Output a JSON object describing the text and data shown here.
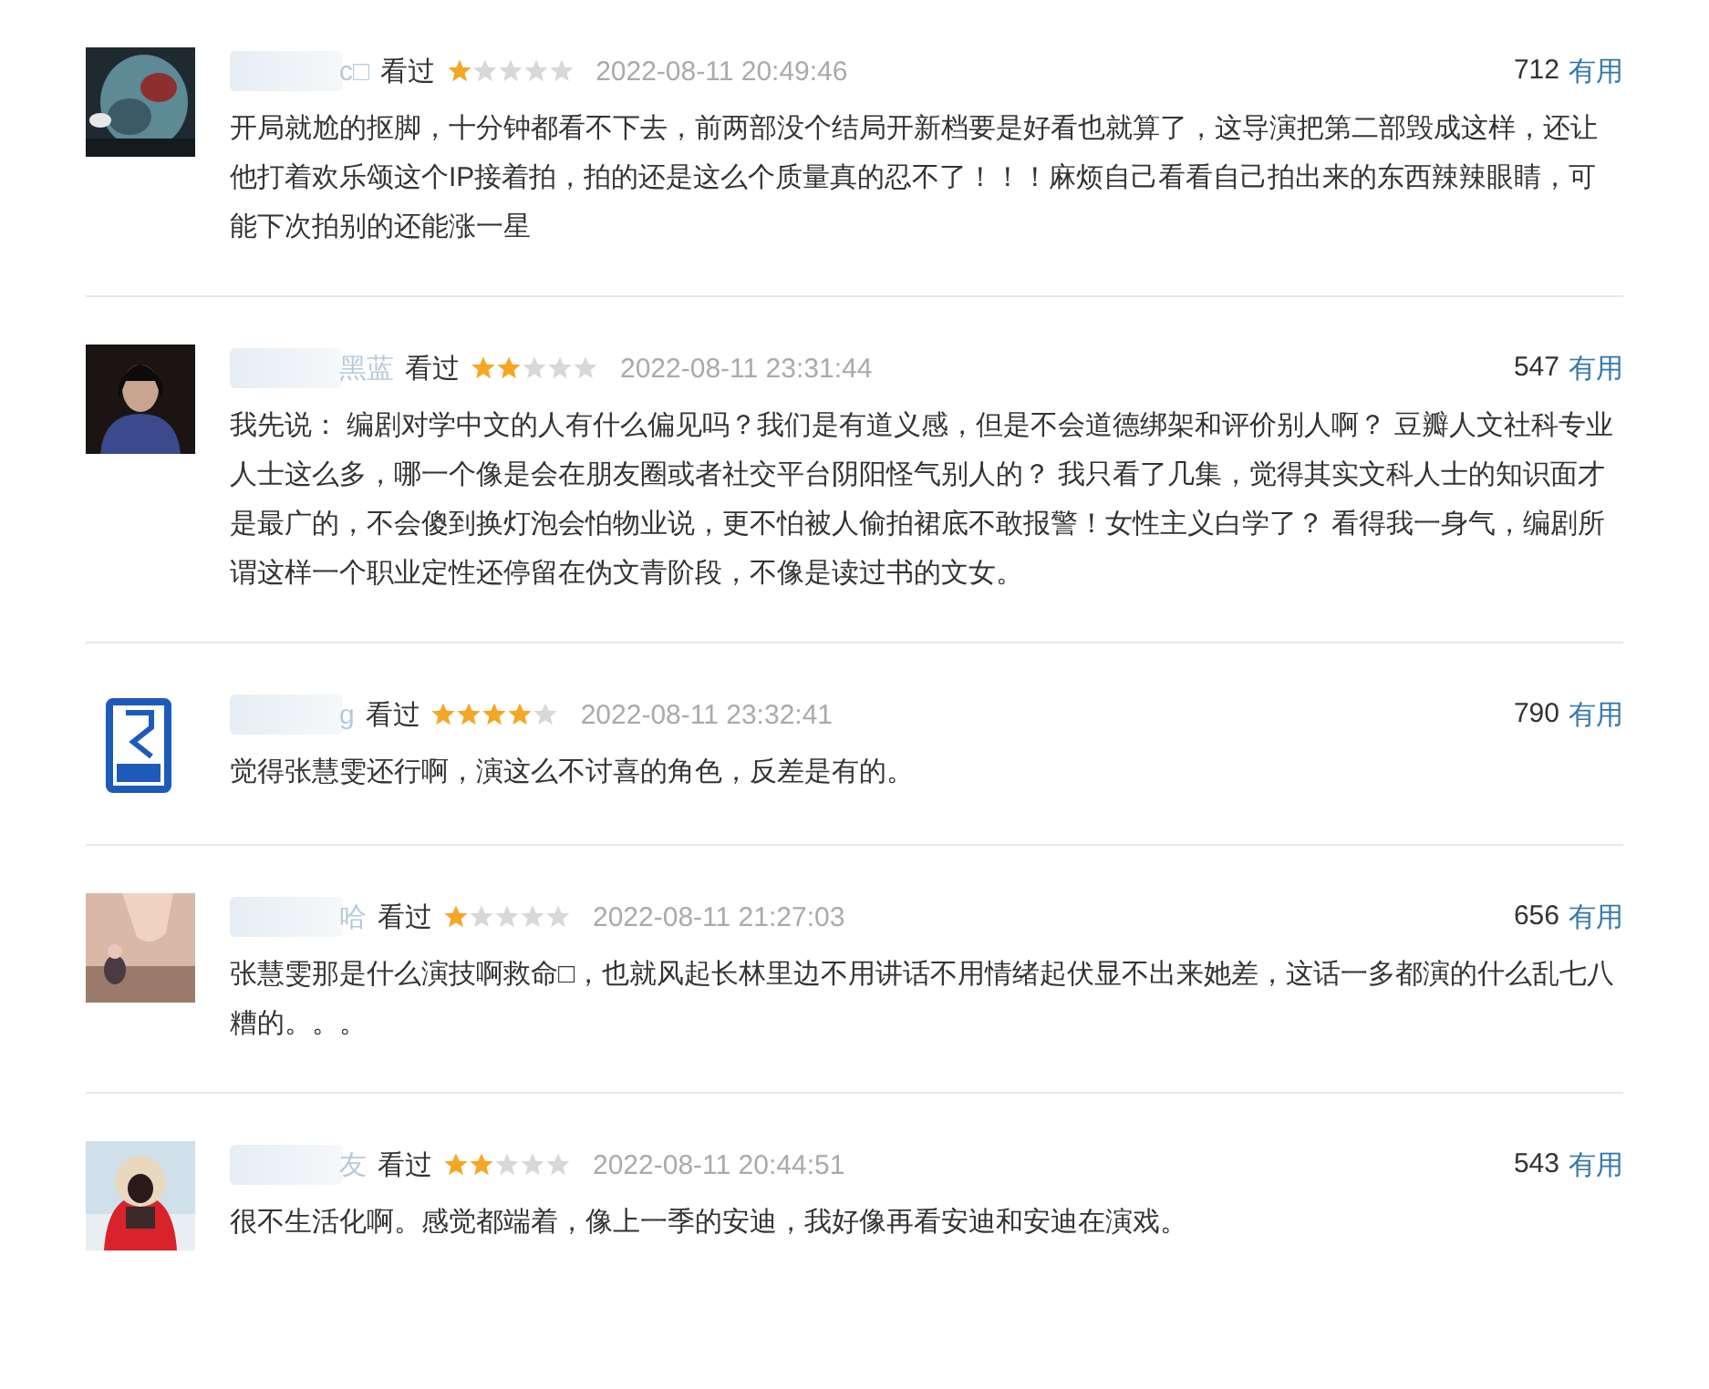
{
  "reviews": [
    {
      "name": "c□",
      "status": "看过",
      "stars": 1,
      "date": "2022-08-11 20:49:46",
      "votes": "712",
      "vote_label": "有用",
      "text": "开局就尬的抠脚，十分钟都看不下去，前两部没个结局开新档要是好看也就算了，这导演把第二部毁成这样，还让他打着欢乐颂这个IP接着拍，拍的还是这么个质量真的忍不了！！！麻烦自己看看自己拍出来的东西辣辣眼睛，可能下次拍别的还能涨一星"
    },
    {
      "name": "黑蓝",
      "status": "看过",
      "stars": 2,
      "date": "2022-08-11 23:31:44",
      "votes": "547",
      "vote_label": "有用",
      "text": "我先说： 编剧对学中文的人有什么偏见吗？我们是有道义感，但是不会道德绑架和评价别人啊？ 豆瓣人文社科专业人士这么多，哪一个像是会在朋友圈或者社交平台阴阳怪气别人的？ 我只看了几集，觉得其实文科人士的知识面才是最广的，不会傻到换灯泡会怕物业说，更不怕被人偷拍裙底不敢报警！女性主义白学了？ 看得我一身气，编剧所谓这样一个职业定性还停留在伪文青阶段，不像是读过书的文女。"
    },
    {
      "name": "g",
      "status": "看过",
      "stars": 4,
      "date": "2022-08-11 23:32:41",
      "votes": "790",
      "vote_label": "有用",
      "text": "觉得张慧雯还行啊，演这么不讨喜的角色，反差是有的。"
    },
    {
      "name": "哈",
      "status": "看过",
      "stars": 1,
      "date": "2022-08-11 21:27:03",
      "votes": "656",
      "vote_label": "有用",
      "text": "张慧雯那是什么演技啊救命□，也就风起长林里边不用讲话不用情绪起伏显不出来她差，这话一多都演的什么乱七八糟的。。。"
    },
    {
      "name": "友",
      "status": "看过",
      "stars": 2,
      "date": "2022-08-11 20:44:51",
      "votes": "543",
      "vote_label": "有用",
      "text": "很不生活化啊。感觉都端着，像上一季的安迪，我好像再看安迪和安迪在演戏。"
    }
  ]
}
